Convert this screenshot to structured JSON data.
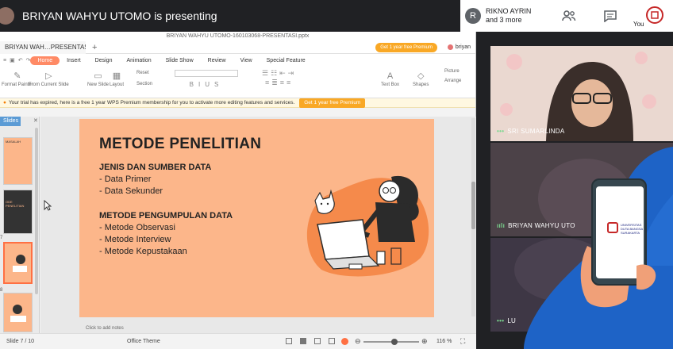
{
  "presenter": {
    "text": "BRIYAN WAHYU UTOMO is presenting"
  },
  "meet_header": {
    "avatar_initial": "R",
    "participant_name": "RIKNO AYRIN",
    "more_text": "and 3 more",
    "you_label": "You"
  },
  "wps": {
    "window_title": "BRIYAN WAHYU UTOMO-160103068-PRESENTASI.pptx",
    "doc_tab": "BRIYAN WAH…PRESENTASI",
    "premium_button": "Get 1 year free Premium",
    "user": "briyan",
    "menu": [
      "Home",
      "Insert",
      "Design",
      "Animation",
      "Slide Show",
      "Review",
      "View",
      "Special Feature"
    ],
    "active_menu": "Home",
    "toolbar": {
      "format_painter": "Format Painter",
      "from_current": "From Current Slide",
      "new_slide": "New Slide",
      "layout": "Layout",
      "reset": "Reset",
      "section": "Section",
      "text_box": "Text Box",
      "shapes": "Shapes",
      "picture": "Picture",
      "arrange": "Arrange"
    },
    "trial_text": "Your trial has expired, here is a free 1 year WPS Premium membership for you to activate more editing features and services.",
    "trial_button": "Get 1 year free Premium",
    "sidebar_title": "Slides",
    "thumb_numbers": [
      "5",
      "6",
      "7",
      "8"
    ],
    "thumb_texts": {
      "t1": "MASALAH",
      "t2": "ODE PENELITIAN"
    },
    "notes_placeholder": "Click to add notes",
    "status": {
      "slide": "Slide 7 / 10",
      "theme": "Office Theme",
      "zoom": "116 %",
      "zoom_level": 0.56
    }
  },
  "slide": {
    "title": "METODE PENELITIAN",
    "section1_heading": "JENIS DAN SUMBER DATA",
    "section1_items": [
      "- Data Primer",
      "- Data Sekunder"
    ],
    "section2_heading": "METODE PENGUMPULAN DATA",
    "section2_items": [
      "- Metode Observasi",
      "- Metode Interview",
      "- Metode Kepustakaan"
    ]
  },
  "participants": [
    {
      "name": "SRI SUMARLINDA"
    },
    {
      "name": "BRIYAN WAHYU UTO"
    },
    {
      "name": "LU"
    }
  ],
  "phone": {
    "university_text": "UNIVERSITAS DUTA BANGSA SURAKARTA"
  },
  "colors": {
    "slide_bg": "#fcb68a",
    "accent_orange": "#ff7043",
    "premium_yellow": "#f9a825",
    "meet_bg": "#202124",
    "brand_blue": "#1e63c6"
  }
}
